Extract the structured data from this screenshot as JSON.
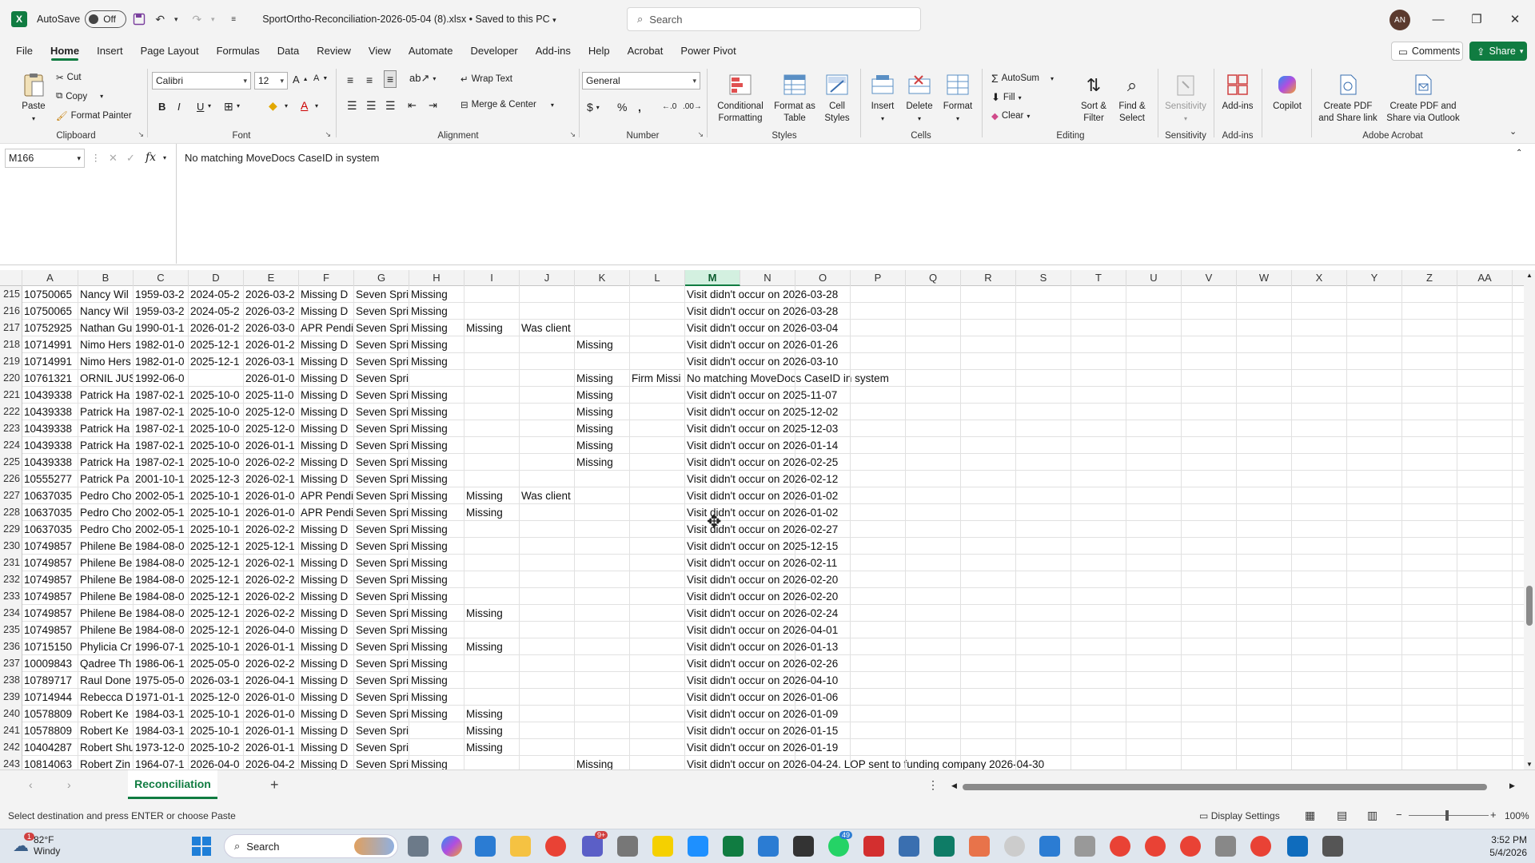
{
  "titlebar": {
    "autosave_label": "AutoSave",
    "autosave_state": "Off",
    "doc_title": "SportOrtho-Reconciliation-2026-05-04 (8).xlsx • Saved to this PC",
    "search_placeholder": "Search",
    "avatar_initials": "AN"
  },
  "menu": {
    "tabs": [
      "File",
      "Home",
      "Insert",
      "Page Layout",
      "Formulas",
      "Data",
      "Review",
      "View",
      "Automate",
      "Developer",
      "Add-ins",
      "Help",
      "Acrobat",
      "Power Pivot"
    ],
    "active": "Home",
    "comments_label": "Comments",
    "share_label": "Share"
  },
  "ribbon": {
    "clipboard": {
      "label": "Clipboard",
      "paste": "Paste",
      "cut": "Cut",
      "copy": "Copy",
      "format_painter": "Format Painter"
    },
    "font": {
      "label": "Font",
      "family": "Calibri",
      "size": "12"
    },
    "alignment": {
      "label": "Alignment",
      "wrap": "Wrap Text",
      "merge": "Merge & Center"
    },
    "number": {
      "label": "Number",
      "format": "General"
    },
    "styles": {
      "label": "Styles",
      "cond_fmt": "Conditional Formatting",
      "fmt_table": "Format as Table",
      "cell_styles": "Cell Styles"
    },
    "cells": {
      "label": "Cells",
      "insert": "Insert",
      "delete": "Delete",
      "format": "Format"
    },
    "editing": {
      "label": "Editing",
      "autosum": "AutoSum",
      "fill": "Fill",
      "clear": "Clear",
      "sort": "Sort & Filter",
      "find": "Find & Select"
    },
    "sensitivity": {
      "label": "Sensitivity",
      "btn": "Sensitivity"
    },
    "addins": {
      "label": "Add-ins",
      "btn": "Add-ins"
    },
    "copilot": {
      "btn": "Copilot"
    },
    "acrobat": {
      "label": "Adobe Acrobat",
      "pdf_share": "Create PDF and Share link",
      "pdf_outlook": "Create PDF and Share via Outlook"
    }
  },
  "formula": {
    "cell_ref": "M166",
    "content": "No matching MoveDocs CaseID in system"
  },
  "columns": [
    "A",
    "B",
    "C",
    "D",
    "E",
    "F",
    "G",
    "H",
    "I",
    "J",
    "K",
    "L",
    "M",
    "N",
    "O",
    "P",
    "Q",
    "R",
    "S",
    "T",
    "U",
    "V",
    "W",
    "X",
    "Y",
    "Z",
    "AA"
  ],
  "selected_column": "M",
  "rows": [
    {
      "n": "215",
      "c": {
        "A": "10750065",
        "B": "Nancy Wil",
        "C": "1959-03-2",
        "D": "2024-05-2",
        "E": "2026-03-2",
        "F": "Missing D",
        "G": "Seven Spri",
        "H": "Missing",
        "M": "Visit didn't occur on 2026-03-28"
      }
    },
    {
      "n": "216",
      "c": {
        "A": "10750065",
        "B": "Nancy Wil",
        "C": "1959-03-2",
        "D": "2024-05-2",
        "E": "2026-03-2",
        "F": "Missing D",
        "G": "Seven Spri",
        "H": "Missing",
        "M": "Visit didn't occur on 2026-03-28"
      }
    },
    {
      "n": "217",
      "c": {
        "A": "10752925",
        "B": "Nathan Gu",
        "C": "1990-01-1",
        "D": "2026-01-2",
        "E": "2026-03-0",
        "F": "APR Pendi",
        "G": "Seven Spri",
        "H": "Missing",
        "I": "Missing",
        "J": "Was client",
        "M": "Visit didn't occur on 2026-03-04"
      }
    },
    {
      "n": "218",
      "c": {
        "A": "10714991",
        "B": "Nimo Hers",
        "C": "1982-01-0",
        "D": "2025-12-1",
        "E": "2026-01-2",
        "F": "Missing D",
        "G": "Seven Spri",
        "H": "Missing",
        "K": "Missing",
        "M": "Visit didn't occur on 2026-01-26"
      }
    },
    {
      "n": "219",
      "c": {
        "A": "10714991",
        "B": "Nimo Hers",
        "C": "1982-01-0",
        "D": "2025-12-1",
        "E": "2026-03-1",
        "F": "Missing D",
        "G": "Seven Spri",
        "H": "Missing",
        "M": "Visit didn't occur on 2026-03-10"
      }
    },
    {
      "n": "220",
      "c": {
        "A": "10761321",
        "B": "ORNIL JUS",
        "C": "1992-06-0",
        "E": "2026-01-0",
        "F": "Missing D",
        "G": "Seven Spri",
        "K": "Missing",
        "L": "Firm Missi",
        "M": "No matching MoveDocs CaseID in system"
      }
    },
    {
      "n": "221",
      "c": {
        "A": "10439338",
        "B": "Patrick Ha",
        "C": "1987-02-1",
        "D": "2025-10-0",
        "E": "2025-11-0",
        "F": "Missing D",
        "G": "Seven Spri",
        "H": "Missing",
        "K": "Missing",
        "M": "Visit didn't occur on 2025-11-07"
      }
    },
    {
      "n": "222",
      "c": {
        "A": "10439338",
        "B": "Patrick Ha",
        "C": "1987-02-1",
        "D": "2025-10-0",
        "E": "2025-12-0",
        "F": "Missing D",
        "G": "Seven Spri",
        "H": "Missing",
        "K": "Missing",
        "M": "Visit didn't occur on 2025-12-02"
      }
    },
    {
      "n": "223",
      "c": {
        "A": "10439338",
        "B": "Patrick Ha",
        "C": "1987-02-1",
        "D": "2025-10-0",
        "E": "2025-12-0",
        "F": "Missing D",
        "G": "Seven Spri",
        "H": "Missing",
        "K": "Missing",
        "M": "Visit didn't occur on 2025-12-03"
      }
    },
    {
      "n": "224",
      "c": {
        "A": "10439338",
        "B": "Patrick Ha",
        "C": "1987-02-1",
        "D": "2025-10-0",
        "E": "2026-01-1",
        "F": "Missing D",
        "G": "Seven Spri",
        "H": "Missing",
        "K": "Missing",
        "M": "Visit didn't occur on 2026-01-14"
      }
    },
    {
      "n": "225",
      "c": {
        "A": "10439338",
        "B": "Patrick Ha",
        "C": "1987-02-1",
        "D": "2025-10-0",
        "E": "2026-02-2",
        "F": "Missing D",
        "G": "Seven Spri",
        "H": "Missing",
        "K": "Missing",
        "M": "Visit didn't occur on 2026-02-25"
      }
    },
    {
      "n": "226",
      "c": {
        "A": "10555277",
        "B": "Patrick Pa",
        "C": "2001-10-1",
        "D": "2025-12-3",
        "E": "2026-02-1",
        "F": "Missing D",
        "G": "Seven Spri",
        "H": "Missing",
        "M": "Visit didn't occur on 2026-02-12"
      }
    },
    {
      "n": "227",
      "c": {
        "A": "10637035",
        "B": "Pedro Cho",
        "C": "2002-05-1",
        "D": "2025-10-1",
        "E": "2026-01-0",
        "F": "APR Pendi",
        "G": "Seven Spri",
        "H": "Missing",
        "I": "Missing",
        "J": "Was client",
        "M": "Visit didn't occur on 2026-01-02"
      }
    },
    {
      "n": "228",
      "c": {
        "A": "10637035",
        "B": "Pedro Cho",
        "C": "2002-05-1",
        "D": "2025-10-1",
        "E": "2026-01-0",
        "F": "APR Pendi",
        "G": "Seven Spri",
        "H": "Missing",
        "I": "Missing",
        "M": "Visit didn't occur on 2026-01-02"
      }
    },
    {
      "n": "229",
      "c": {
        "A": "10637035",
        "B": "Pedro Cho",
        "C": "2002-05-1",
        "D": "2025-10-1",
        "E": "2026-02-2",
        "F": "Missing D",
        "G": "Seven Spri",
        "H": "Missing",
        "M": "Visit didn't occur on 2026-02-27"
      }
    },
    {
      "n": "230",
      "c": {
        "A": "10749857",
        "B": "Philene Be",
        "C": "1984-08-0",
        "D": "2025-12-1",
        "E": "2025-12-1",
        "F": "Missing D",
        "G": "Seven Spri",
        "H": "Missing",
        "M": "Visit didn't occur on 2025-12-15"
      }
    },
    {
      "n": "231",
      "c": {
        "A": "10749857",
        "B": "Philene Be",
        "C": "1984-08-0",
        "D": "2025-12-1",
        "E": "2026-02-1",
        "F": "Missing D",
        "G": "Seven Spri",
        "H": "Missing",
        "M": "Visit didn't occur on 2026-02-11"
      }
    },
    {
      "n": "232",
      "c": {
        "A": "10749857",
        "B": "Philene Be",
        "C": "1984-08-0",
        "D": "2025-12-1",
        "E": "2026-02-2",
        "F": "Missing D",
        "G": "Seven Spri",
        "H": "Missing",
        "M": "Visit didn't occur on 2026-02-20"
      }
    },
    {
      "n": "233",
      "c": {
        "A": "10749857",
        "B": "Philene Be",
        "C": "1984-08-0",
        "D": "2025-12-1",
        "E": "2026-02-2",
        "F": "Missing D",
        "G": "Seven Spri",
        "H": "Missing",
        "M": "Visit didn't occur on 2026-02-20"
      }
    },
    {
      "n": "234",
      "c": {
        "A": "10749857",
        "B": "Philene Be",
        "C": "1984-08-0",
        "D": "2025-12-1",
        "E": "2026-02-2",
        "F": "Missing D",
        "G": "Seven Spri",
        "H": "Missing",
        "I": "Missing",
        "M": "Visit didn't occur on 2026-02-24"
      }
    },
    {
      "n": "235",
      "c": {
        "A": "10749857",
        "B": "Philene Be",
        "C": "1984-08-0",
        "D": "2025-12-1",
        "E": "2026-04-0",
        "F": "Missing D",
        "G": "Seven Spri",
        "H": "Missing",
        "M": "Visit didn't occur on 2026-04-01"
      }
    },
    {
      "n": "236",
      "c": {
        "A": "10715150",
        "B": "Phylicia Cr",
        "C": "1996-07-1",
        "D": "2025-10-1",
        "E": "2026-01-1",
        "F": "Missing D",
        "G": "Seven Spri",
        "H": "Missing",
        "I": "Missing",
        "M": "Visit didn't occur on 2026-01-13"
      }
    },
    {
      "n": "237",
      "c": {
        "A": "10009843",
        "B": "Qadree Th",
        "C": "1986-06-1",
        "D": "2025-05-0",
        "E": "2026-02-2",
        "F": "Missing D",
        "G": "Seven Spri",
        "H": "Missing",
        "M": "Visit didn't occur on 2026-02-26"
      }
    },
    {
      "n": "238",
      "c": {
        "A": "10789717",
        "B": "Raul Done",
        "C": "1975-05-0",
        "D": "2026-03-1",
        "E": "2026-04-1",
        "F": "Missing D",
        "G": "Seven Spri",
        "H": "Missing",
        "M": "Visit didn't occur on 2026-04-10"
      }
    },
    {
      "n": "239",
      "c": {
        "A": "10714944",
        "B": "Rebecca D",
        "C": "1971-01-1",
        "D": "2025-12-0",
        "E": "2026-01-0",
        "F": "Missing D",
        "G": "Seven Spri",
        "H": "Missing",
        "M": "Visit didn't occur on 2026-01-06"
      }
    },
    {
      "n": "240",
      "c": {
        "A": "10578809",
        "B": "Robert Ke",
        "C": "1984-03-1",
        "D": "2025-10-1",
        "E": "2026-01-0",
        "F": "Missing D",
        "G": "Seven Spri",
        "H": "Missing",
        "I": "Missing",
        "M": "Visit didn't occur on 2026-01-09"
      }
    },
    {
      "n": "241",
      "c": {
        "A": "10578809",
        "B": "Robert Ke",
        "C": "1984-03-1",
        "D": "2025-10-1",
        "E": "2026-01-1",
        "F": "Missing D",
        "G": "Seven Spri",
        "I": "Missing",
        "M": "Visit didn't occur on 2026-01-15"
      }
    },
    {
      "n": "242",
      "c": {
        "A": "10404287",
        "B": "Robert Shu",
        "C": "1973-12-0",
        "D": "2025-10-2",
        "E": "2026-01-1",
        "F": "Missing D",
        "G": "Seven Spri",
        "I": "Missing",
        "M": "Visit didn't occur on 2026-01-19"
      }
    },
    {
      "n": "243",
      "c": {
        "A": "10814063",
        "B": "Robert Zin",
        "C": "1964-07-1",
        "D": "2026-04-0",
        "E": "2026-04-2",
        "F": "Missing D",
        "G": "Seven Spri",
        "H": "Missing",
        "K": "Missing",
        "M": "Visit didn't occur on 2026-04-24. LOP sent to funding company 2026-04-30"
      }
    }
  ],
  "sheet": {
    "tab_name": "Reconciliation"
  },
  "status": {
    "message": "Select destination and press ENTER or choose Paste",
    "display_settings": "Display Settings",
    "zoom": "100%"
  },
  "taskbar": {
    "weather_temp": "82°F",
    "weather_desc": "Windy",
    "search_label": "Search",
    "time": "3:52 PM",
    "date": "5/4/2026",
    "badge_weather": "1",
    "badge_teams": "9+",
    "badge_whatsapp": "49"
  }
}
